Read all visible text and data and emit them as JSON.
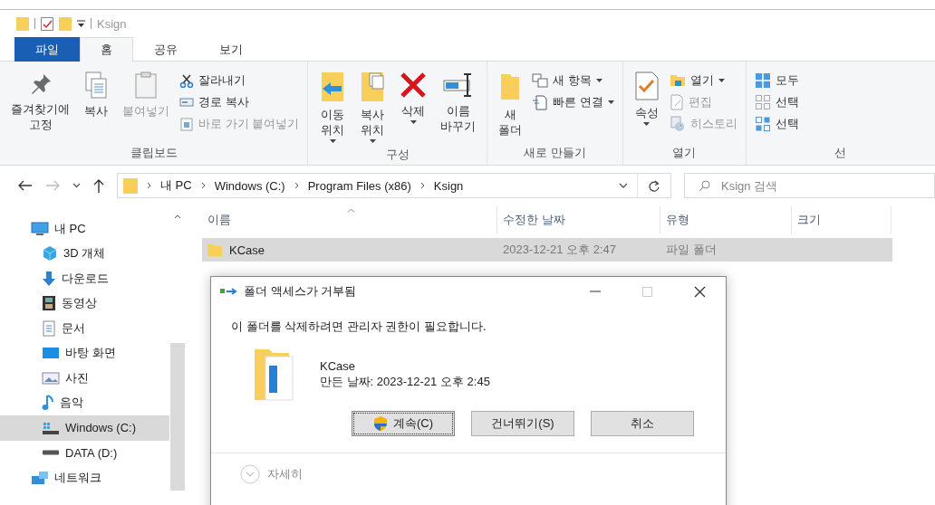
{
  "window": {
    "title": "Ksign"
  },
  "tabs": [
    {
      "label": "파일",
      "kind": "file",
      "selected": false
    },
    {
      "label": "홈",
      "kind": "tab",
      "selected": true
    },
    {
      "label": "공유",
      "kind": "tab",
      "selected": false
    },
    {
      "label": "보기",
      "kind": "tab",
      "selected": false
    }
  ],
  "ribbon": [
    {
      "label": "클립보드",
      "big": [
        {
          "label": "즐겨찾기에\n고정",
          "disabled": false,
          "dropdown": false
        },
        {
          "label": "복사",
          "disabled": false,
          "dropdown": false
        },
        {
          "label": "붙여넣기",
          "disabled": true,
          "dropdown": false
        }
      ],
      "small": [
        {
          "label": "잘라내기",
          "disabled": false,
          "dropdown": false
        },
        {
          "label": "경로 복사",
          "disabled": false,
          "dropdown": false
        },
        {
          "label": "바로 가기 붙여넣기",
          "disabled": true,
          "dropdown": false
        }
      ]
    },
    {
      "label": "구성",
      "big": [
        {
          "label": "이동\n위치",
          "disabled": false,
          "dropdown": true
        },
        {
          "label": "복사\n위치",
          "disabled": false,
          "dropdown": true
        },
        {
          "label": "삭제",
          "disabled": false,
          "dropdown": true
        },
        {
          "label": "이름\n바꾸기",
          "disabled": false,
          "dropdown": false
        }
      ]
    },
    {
      "label": "새로 만들기",
      "big": [
        {
          "label": "새\n폴더",
          "disabled": false,
          "dropdown": false
        }
      ],
      "small": [
        {
          "label": "새 항목",
          "disabled": false,
          "dropdown": true
        },
        {
          "label": "빠른 연결",
          "disabled": false,
          "dropdown": true
        }
      ]
    },
    {
      "label": "열기",
      "big": [
        {
          "label": "속성",
          "disabled": false,
          "dropdown": true
        }
      ],
      "small": [
        {
          "label": "열기",
          "disabled": false,
          "dropdown": true
        },
        {
          "label": "편집",
          "disabled": true,
          "dropdown": false
        },
        {
          "label": "히스토리",
          "disabled": true,
          "dropdown": false
        }
      ]
    },
    {
      "label": "선",
      "small": [
        {
          "label": "모두",
          "disabled": false,
          "dropdown": false
        },
        {
          "label": "선택",
          "disabled": false,
          "dropdown": false
        },
        {
          "label": "선택",
          "disabled": false,
          "dropdown": false
        }
      ]
    }
  ],
  "address": {
    "back_disabled": false,
    "forward_disabled": true,
    "path": [
      "내 PC",
      "Windows (C:)",
      "Program Files (x86)",
      "Ksign"
    ]
  },
  "search": {
    "placeholder": "Ksign 검색"
  },
  "sidebar": {
    "items": [
      {
        "label": "내 PC",
        "selected": false,
        "children": [
          {
            "label": "3D 개체",
            "selected": false
          },
          {
            "label": "다운로드",
            "selected": false
          },
          {
            "label": "동영상",
            "selected": false
          },
          {
            "label": "문서",
            "selected": false
          },
          {
            "label": "바탕 화면",
            "selected": false
          },
          {
            "label": "사진",
            "selected": false
          },
          {
            "label": "음악",
            "selected": false
          },
          {
            "label": "Windows (C:)",
            "selected": true
          },
          {
            "label": "DATA (D:)",
            "selected": false
          }
        ]
      },
      {
        "label": "네트워크",
        "selected": false
      }
    ]
  },
  "table": {
    "columns": [
      "이름",
      "수정한 날짜",
      "유형",
      "크기"
    ],
    "rows": [
      {
        "cells": [
          "KCase",
          "2023-12-21 오후 2:47",
          "파일 폴더"
        ],
        "selected": true
      }
    ]
  },
  "dialog": {
    "title": "폴더 액세스가 거부됨",
    "message": "이 폴더를 삭제하려면 관리자 권한이 필요합니다.",
    "item_name": "KCase",
    "item_date": "만든 날짜: 2023-12-21 오후 2:45",
    "buttons": [
      {
        "label": "계속(C)",
        "focused": true,
        "shield": true
      },
      {
        "label": "건너뛰기(S)",
        "focused": false,
        "shield": false
      },
      {
        "label": "취소",
        "focused": false,
        "shield": false
      }
    ],
    "details": "자세히"
  }
}
